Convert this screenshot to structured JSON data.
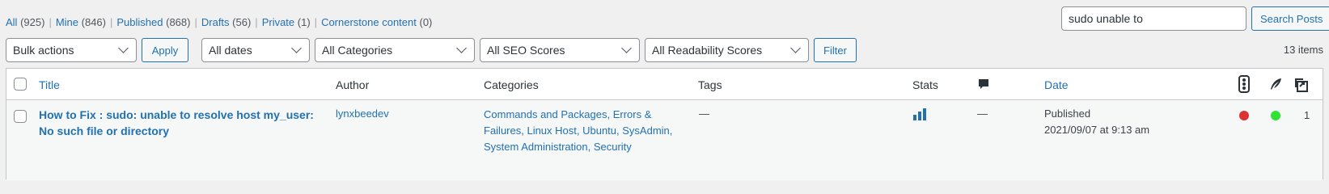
{
  "filters_nav": {
    "all": {
      "label": "All",
      "count": "(925)"
    },
    "mine": {
      "label": "Mine",
      "count": "(846)"
    },
    "published": {
      "label": "Published",
      "count": "(868)"
    },
    "drafts": {
      "label": "Drafts",
      "count": "(56)"
    },
    "private": {
      "label": "Private",
      "count": "(1)"
    },
    "cornerstone": {
      "label": "Cornerstone content",
      "count": "(0)"
    },
    "separator": "|"
  },
  "search": {
    "value": "sudo unable to",
    "button": "Search Posts"
  },
  "tablenav": {
    "bulk_actions": "Bulk actions",
    "apply": "Apply",
    "dates": "All dates",
    "categories": "All Categories",
    "seo": "All SEO Scores",
    "readability": "All Readability Scores",
    "filter": "Filter",
    "items": "13 items"
  },
  "columns": {
    "title": "Title",
    "author": "Author",
    "categories": "Categories",
    "tags": "Tags",
    "stats": "Stats",
    "comments_icon": "comment-icon",
    "date": "Date",
    "seo_icon": "traffic-light-icon",
    "readability_icon": "feather-icon",
    "links_icon": "link-stack-icon"
  },
  "rows": [
    {
      "title_line1": "How to Fix : sudo: unable to resolve host my_user:",
      "title_line2": "No such file or directory",
      "author": "lynxbeedev",
      "categories_line1": "Commands and Packages, Errors &",
      "categories_line2": "Failures, Linux Host, Ubuntu, SysAdmin,",
      "categories_line3": "System Administration, Security",
      "tags": "—",
      "comments": "—",
      "date_status": "Published",
      "date_value": "2021/09/07 at 9:13 am",
      "seo_color": "#dc3232",
      "readability_color": "#2fe233",
      "links": "1"
    }
  ],
  "colors": {
    "link": "#2271b1",
    "bad": "#dc3232",
    "good": "#2fe233"
  }
}
